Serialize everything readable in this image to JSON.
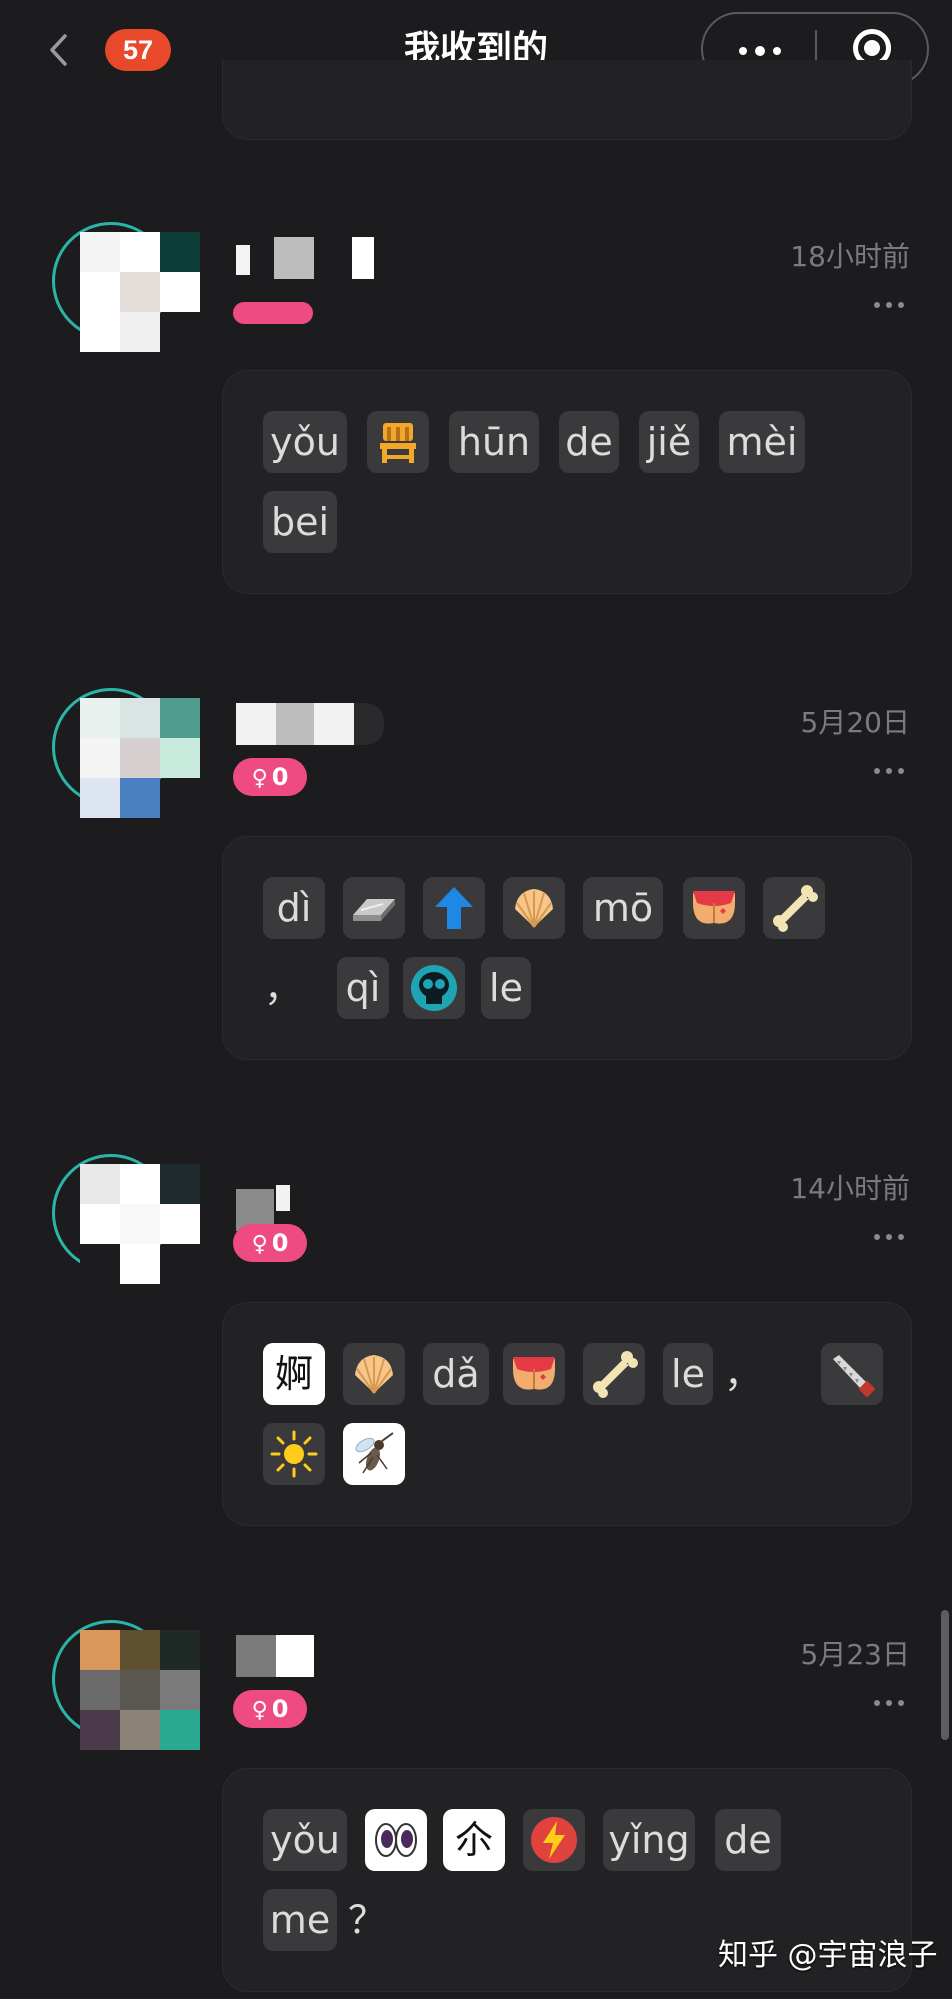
{
  "header": {
    "badge_count": "57",
    "title": "我收到的"
  },
  "posts": [
    {
      "time": "18小时前",
      "tag": "",
      "line1": [
        "yǒu",
        "chair-emoji",
        "hūn",
        "de",
        "jiě",
        "mèi"
      ],
      "line2": [
        "bei"
      ]
    },
    {
      "time": "5月20日",
      "tag": "0",
      "line1": [
        "dì",
        "silver-bar-emoji",
        "up-arrow-emoji",
        "shell-emoji",
        "mō",
        "butt-emoji",
        "bone-emoji"
      ],
      "line2": [
        "，",
        "qì",
        "skull-emoji",
        "le"
      ]
    },
    {
      "time": "14小时前",
      "tag": "0",
      "line1": [
        "婀",
        "shell-emoji",
        "dǎ",
        "butt-emoji",
        "bone-emoji",
        "le",
        "，",
        "saw-emoji"
      ],
      "line2": [
        "sun-emoji",
        "mosquito-emoji"
      ]
    },
    {
      "time": "5月23日",
      "tag": "0",
      "line1": [
        "yǒu",
        "eyes-emoji",
        "尒",
        "lightning-emoji",
        "yǐng",
        "de"
      ],
      "line2": [
        "me",
        "？"
      ]
    }
  ],
  "watermark": "知乎 @宇宙浪子",
  "colors": {
    "background": "#1c1c1e",
    "card": "#222225",
    "chip": "#3a3a3d",
    "badge": "#e8492b",
    "tag": "#ee4b82",
    "avatar_ring": "#2bb5a8"
  }
}
